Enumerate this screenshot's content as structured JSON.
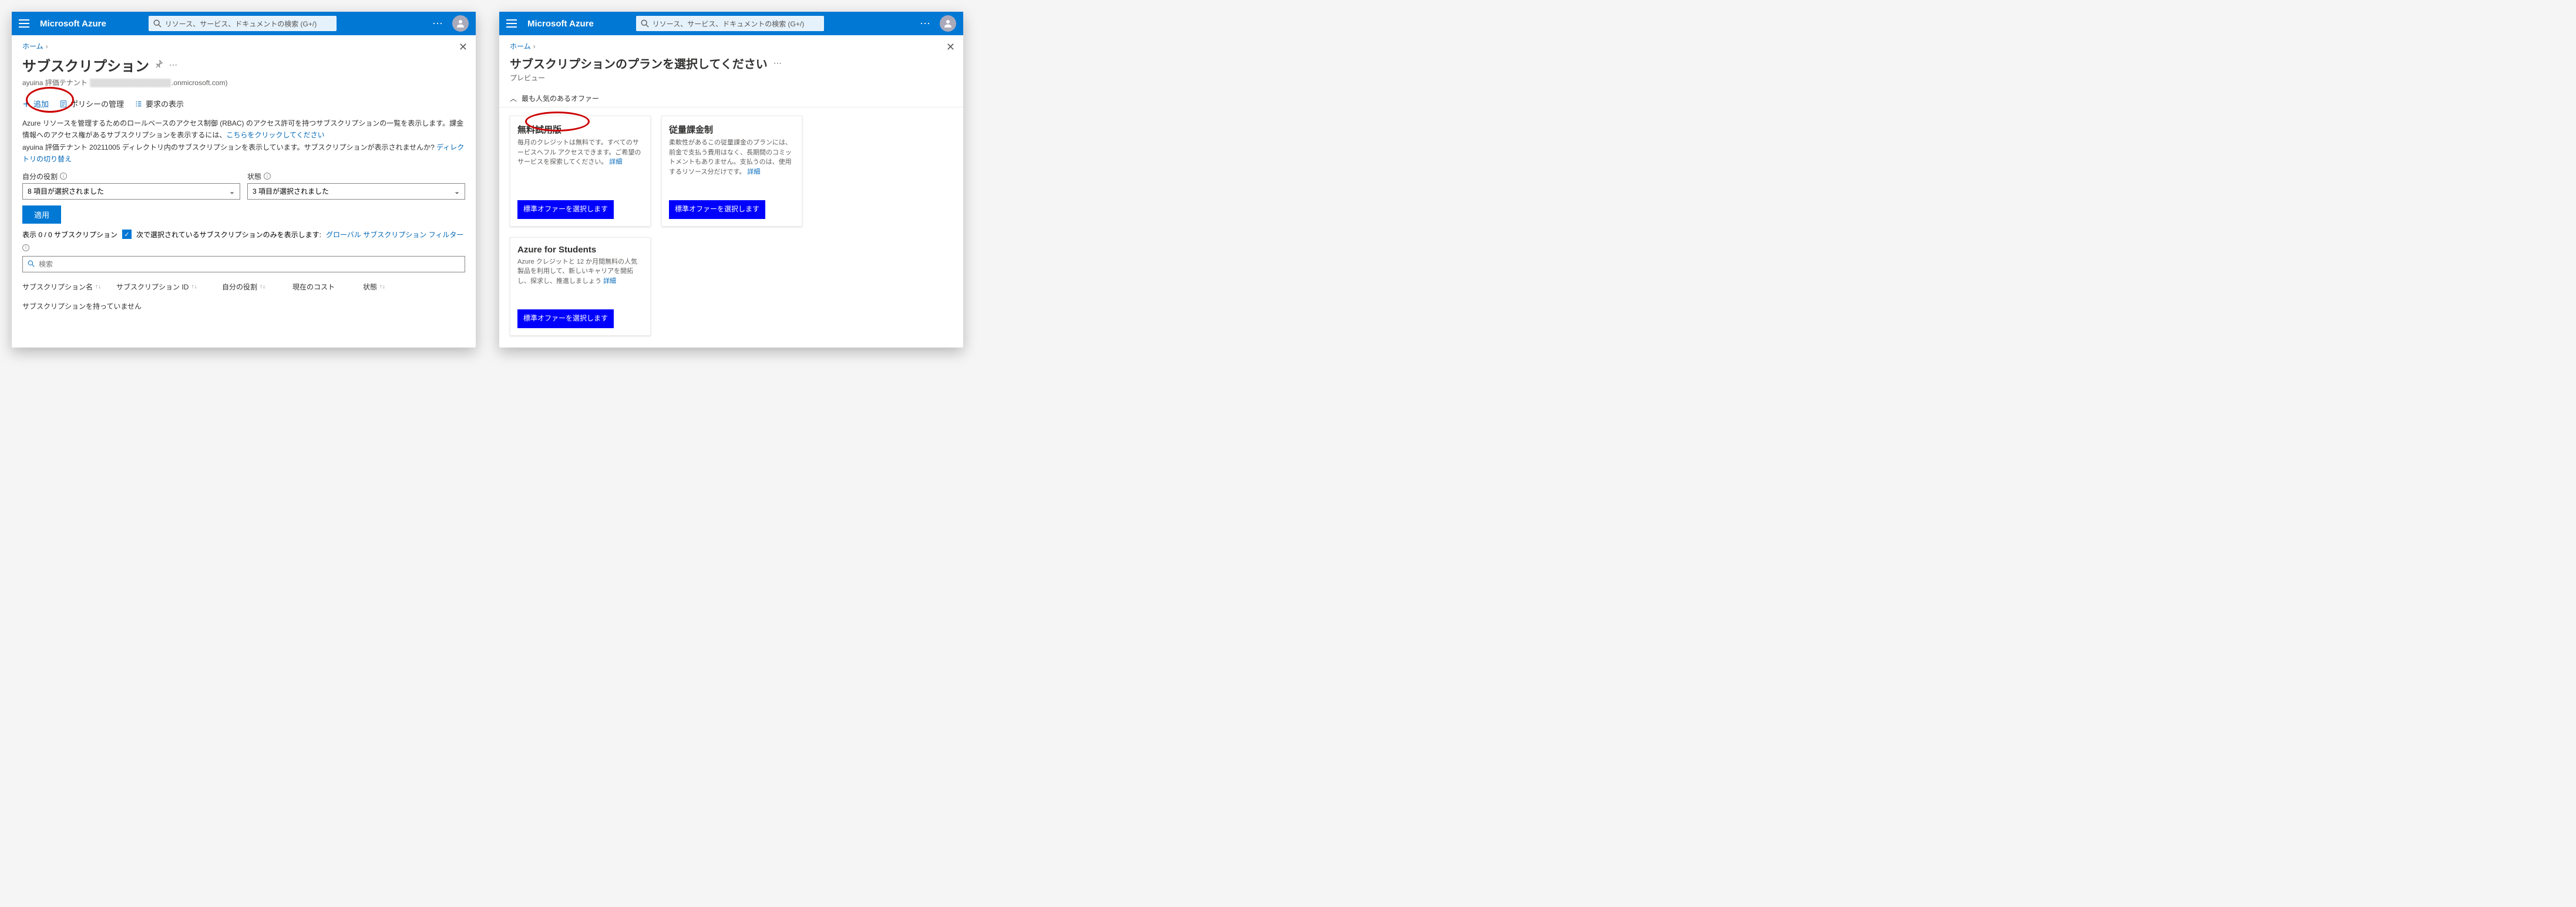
{
  "brand": "Microsoft Azure",
  "search_placeholder": "リソース、サービス、ドキュメントの検索 (G+/)",
  "breadcrumb_home": "ホーム",
  "pane1": {
    "title": "サブスクリプション",
    "tenant_prefix": "ayuina 評価テナント",
    "tenant_suffix": ".onmicrosoft.com)",
    "toolbar": {
      "add": "追加",
      "policy": "ポリシーの管理",
      "requests": "要求の表示"
    },
    "info_line1a": "Azure リソースを管理するためのロールベースのアクセス制御 (RBAC) のアクセス許可を持つサブスクリプションの一覧を表示します。課金情報へのアクセス権があるサブスクリプションを表示するには、",
    "info_line1_link": "こちらをクリックしてください",
    "info_line2a": "ayuina 評価テナント 20211005 ディレクトリ内のサブスクリプションを表示しています。サブスクリプションが表示されませんか? ",
    "info_line2_link": "ディレクトリの切り替え",
    "filter1_label": "自分の役割",
    "filter1_value": "8 項目が選択されました",
    "filter2_label": "状態",
    "filter2_value": "3 項目が選択されました",
    "apply": "適用",
    "showing": "表示 0 / 0 サブスクリプション",
    "checkbox_label": "次で選択されているサブスクリプションのみを表示します:",
    "global_filter_link": "グローバル サブスクリプション フィルター",
    "search_ph": "検索",
    "columns": {
      "name": "サブスクリプション名",
      "id": "サブスクリプション ID",
      "role": "自分の役割",
      "cost": "現在のコスト",
      "status": "状態"
    },
    "empty": "サブスクリプションを持っていません"
  },
  "pane2": {
    "title": "サブスクリプションのプランを選択してください",
    "subtitle": "プレビュー",
    "collapse_label": "最も人気のあるオファー",
    "offers": [
      {
        "title": "無料試用版",
        "desc": "毎月のクレジットは無料です。すべてのサービスへフル アクセスできます。ご希望のサービスを探索してください。",
        "link": "詳細",
        "btn": "標準オファーを選択します"
      },
      {
        "title": "従量課金制",
        "desc": "柔軟性があるこの従量課金のプランには、前金で支払う費用はなく、長期間のコミットメントもありません。支払うのは、使用するリソース分だけです。",
        "link": "詳細",
        "btn": "標準オファーを選択します"
      },
      {
        "title": "Azure for Students",
        "desc": "Azure クレジットと 12 か月間無料の人気製品を利用して、新しいキャリアを開拓し、探求し、推進しましょう",
        "link": "詳細",
        "btn": "標準オファーを選択します"
      }
    ]
  }
}
